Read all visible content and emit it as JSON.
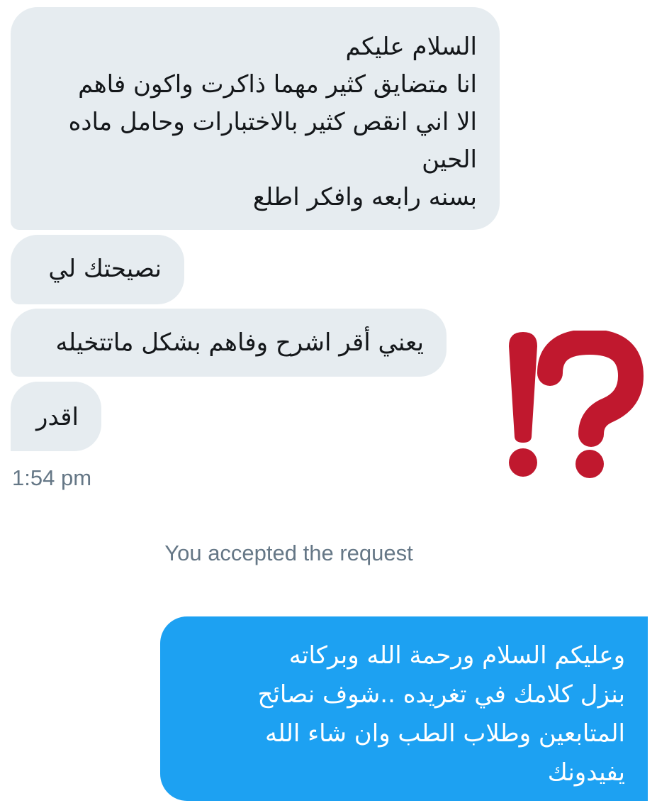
{
  "conversation": {
    "incoming_messages": [
      {
        "lines": [
          "السلام عليكم",
          "انا متضايق كثير مهما ذاكرت واكون فاهم",
          "الا اني انقص كثير بالاختبارات وحامل ماده",
          "الحين",
          "بسنه رابعه وافكر اطلع"
        ]
      },
      {
        "lines": [
          "نصيحتك لي"
        ]
      },
      {
        "lines": [
          "يعني أقر اشرح وفاهم بشكل ماتتخيله"
        ]
      },
      {
        "lines": [
          "اقدر"
        ]
      }
    ],
    "timestamp": "1:54 pm",
    "system_message": "You accepted the request",
    "outgoing_message": {
      "lines": [
        "وعليكم السلام ورحمة الله وبركاته",
        "بنزل كلامك في تغريده ..شوف نصائح",
        "المتابعين وطلاب الطب وان شاء الله",
        "يفيدونك"
      ]
    }
  },
  "decoration": {
    "icon": "interrobang-icon",
    "color": "#c0182e"
  },
  "colors": {
    "incoming_bubble": "#e6ecf0",
    "outgoing_bubble": "#1da1f2",
    "muted_text": "#657786"
  }
}
